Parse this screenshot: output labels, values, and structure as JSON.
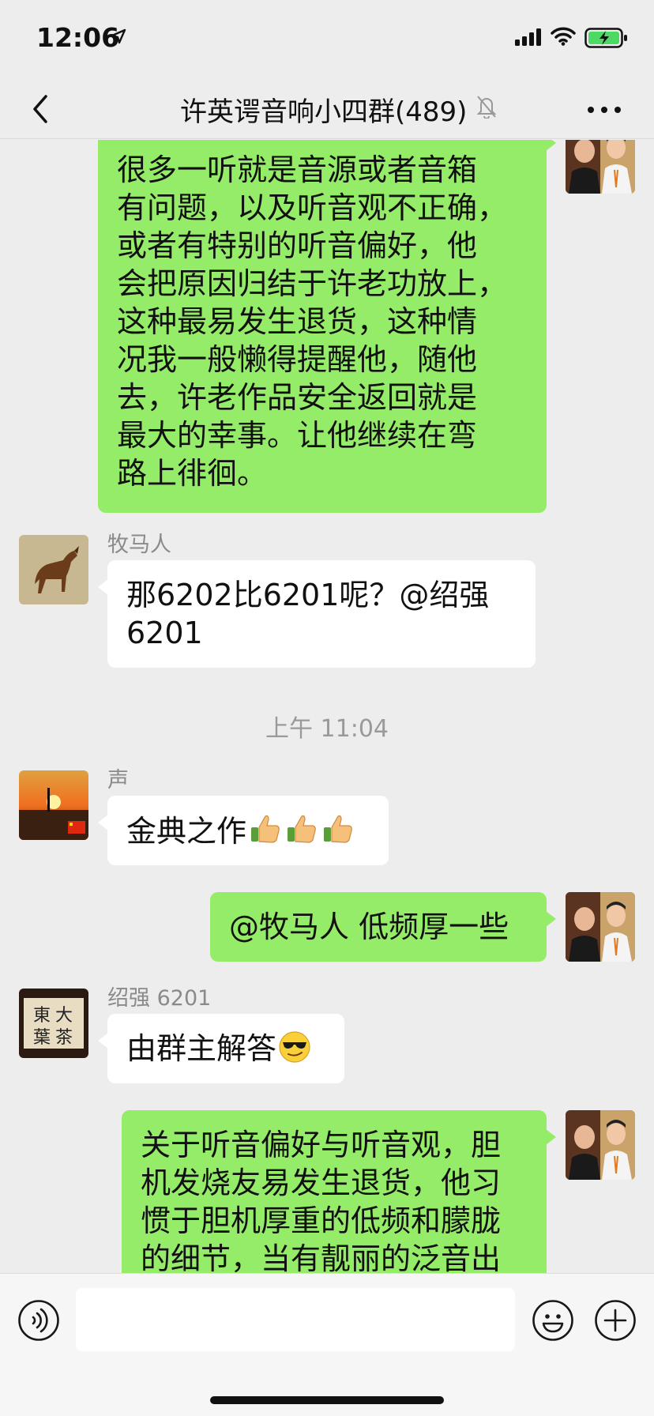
{
  "status_bar": {
    "time": "12:06"
  },
  "header": {
    "title": "许英谔音响小四群(489)"
  },
  "messages": [
    {
      "side": "right",
      "lines": [
        "很多一听就是音源或者音箱",
        "有问题，以及听音观不正确，",
        "或者有特别的听音偏好，他",
        "会把原因归结于许老功放上，",
        "这种最易发生退货，这种情",
        "况我一般懒得提醒他，随他",
        "去，许老作品安全返回就是",
        "最大的幸事。让他继续在弯",
        "路上徘徊。"
      ]
    },
    {
      "side": "left",
      "sender": "牧马人",
      "lines": [
        "那6202比6201呢？@绍强",
        "6201"
      ]
    },
    {
      "timestamp": "上午 11:04"
    },
    {
      "side": "left",
      "sender": "声",
      "text": "金典之作"
    },
    {
      "side": "right",
      "text": "@牧马人 低频厚一些"
    },
    {
      "side": "left",
      "sender": "绍强 6201",
      "text": "由群主解答"
    },
    {
      "side": "right",
      "lines": [
        "关于听音偏好与听音观，胆",
        "机发烧友易发生退货，他习",
        "惯于胆机厚重的低频和朦胧",
        "的细节，当有靓丽的泛音出"
      ]
    }
  ],
  "avatar_text": {
    "shaoqiang": [
      "大",
      "茶",
      "東",
      "葉"
    ]
  },
  "colors": {
    "my_bubble": "#95ec69",
    "other_bubble": "#ffffff",
    "background": "#ededed"
  }
}
